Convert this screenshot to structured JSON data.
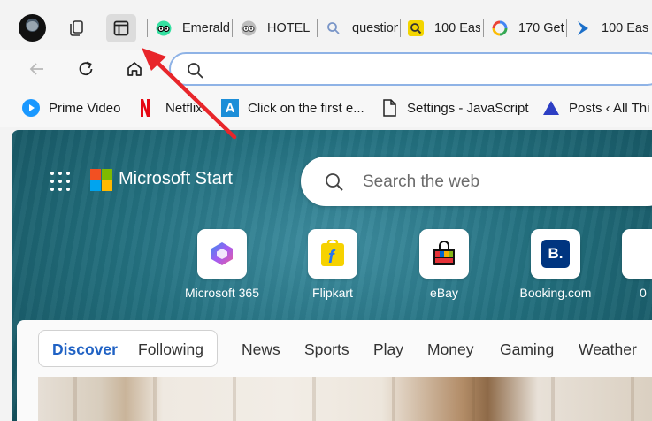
{
  "browser": {
    "tabs": [
      {
        "title": "Emerald",
        "icon": "tripadvisor-owl-icon"
      },
      {
        "title": "HOTEL",
        "icon": "tripadvisor-owl-icon"
      },
      {
        "title": "question",
        "icon": "search-icon"
      },
      {
        "title": "100 Eas",
        "icon": "yellow-search-icon"
      },
      {
        "title": "170 Get",
        "icon": "google-loading-icon"
      },
      {
        "title": "100 Eas",
        "icon": "blue-arrow-icon"
      }
    ],
    "toolbar_buttons": [
      "workspaces-icon",
      "vertical-tabs-icon"
    ],
    "address_bar": {
      "value": "",
      "placeholder": ""
    },
    "favorites": [
      {
        "label": "Prime Video",
        "icon": "prime-video-icon"
      },
      {
        "label": "Netflix",
        "icon": "netflix-icon"
      },
      {
        "label": "Click on the first e...",
        "icon": "a-logo-icon"
      },
      {
        "label": "Settings - JavaScript",
        "icon": "document-icon"
      },
      {
        "label": "Posts ‹ All Thi",
        "icon": "triangle-logo-icon"
      }
    ]
  },
  "start_page": {
    "brand": "Microsoft Start",
    "search_placeholder": "Search the web",
    "quick_links": [
      {
        "label": "Microsoft 365",
        "icon": "microsoft-365-icon"
      },
      {
        "label": "Flipkart",
        "icon": "flipkart-icon"
      },
      {
        "label": "eBay",
        "icon": "ebay-bag-icon"
      },
      {
        "label": "Booking.com",
        "icon": "booking-icon"
      },
      {
        "label": "0",
        "icon": "partial-icon"
      }
    ],
    "feed_tabs": [
      {
        "label": "Discover",
        "selected": true
      },
      {
        "label": "Following",
        "selected": false
      },
      {
        "label": "News",
        "selected": false
      },
      {
        "label": "Sports",
        "selected": false
      },
      {
        "label": "Play",
        "selected": false
      },
      {
        "label": "Money",
        "selected": false
      },
      {
        "label": "Gaming",
        "selected": false
      },
      {
        "label": "Weather",
        "selected": false
      }
    ]
  },
  "colors": {
    "annotation_arrow": "#e8262b",
    "accent": "#2062c4"
  }
}
